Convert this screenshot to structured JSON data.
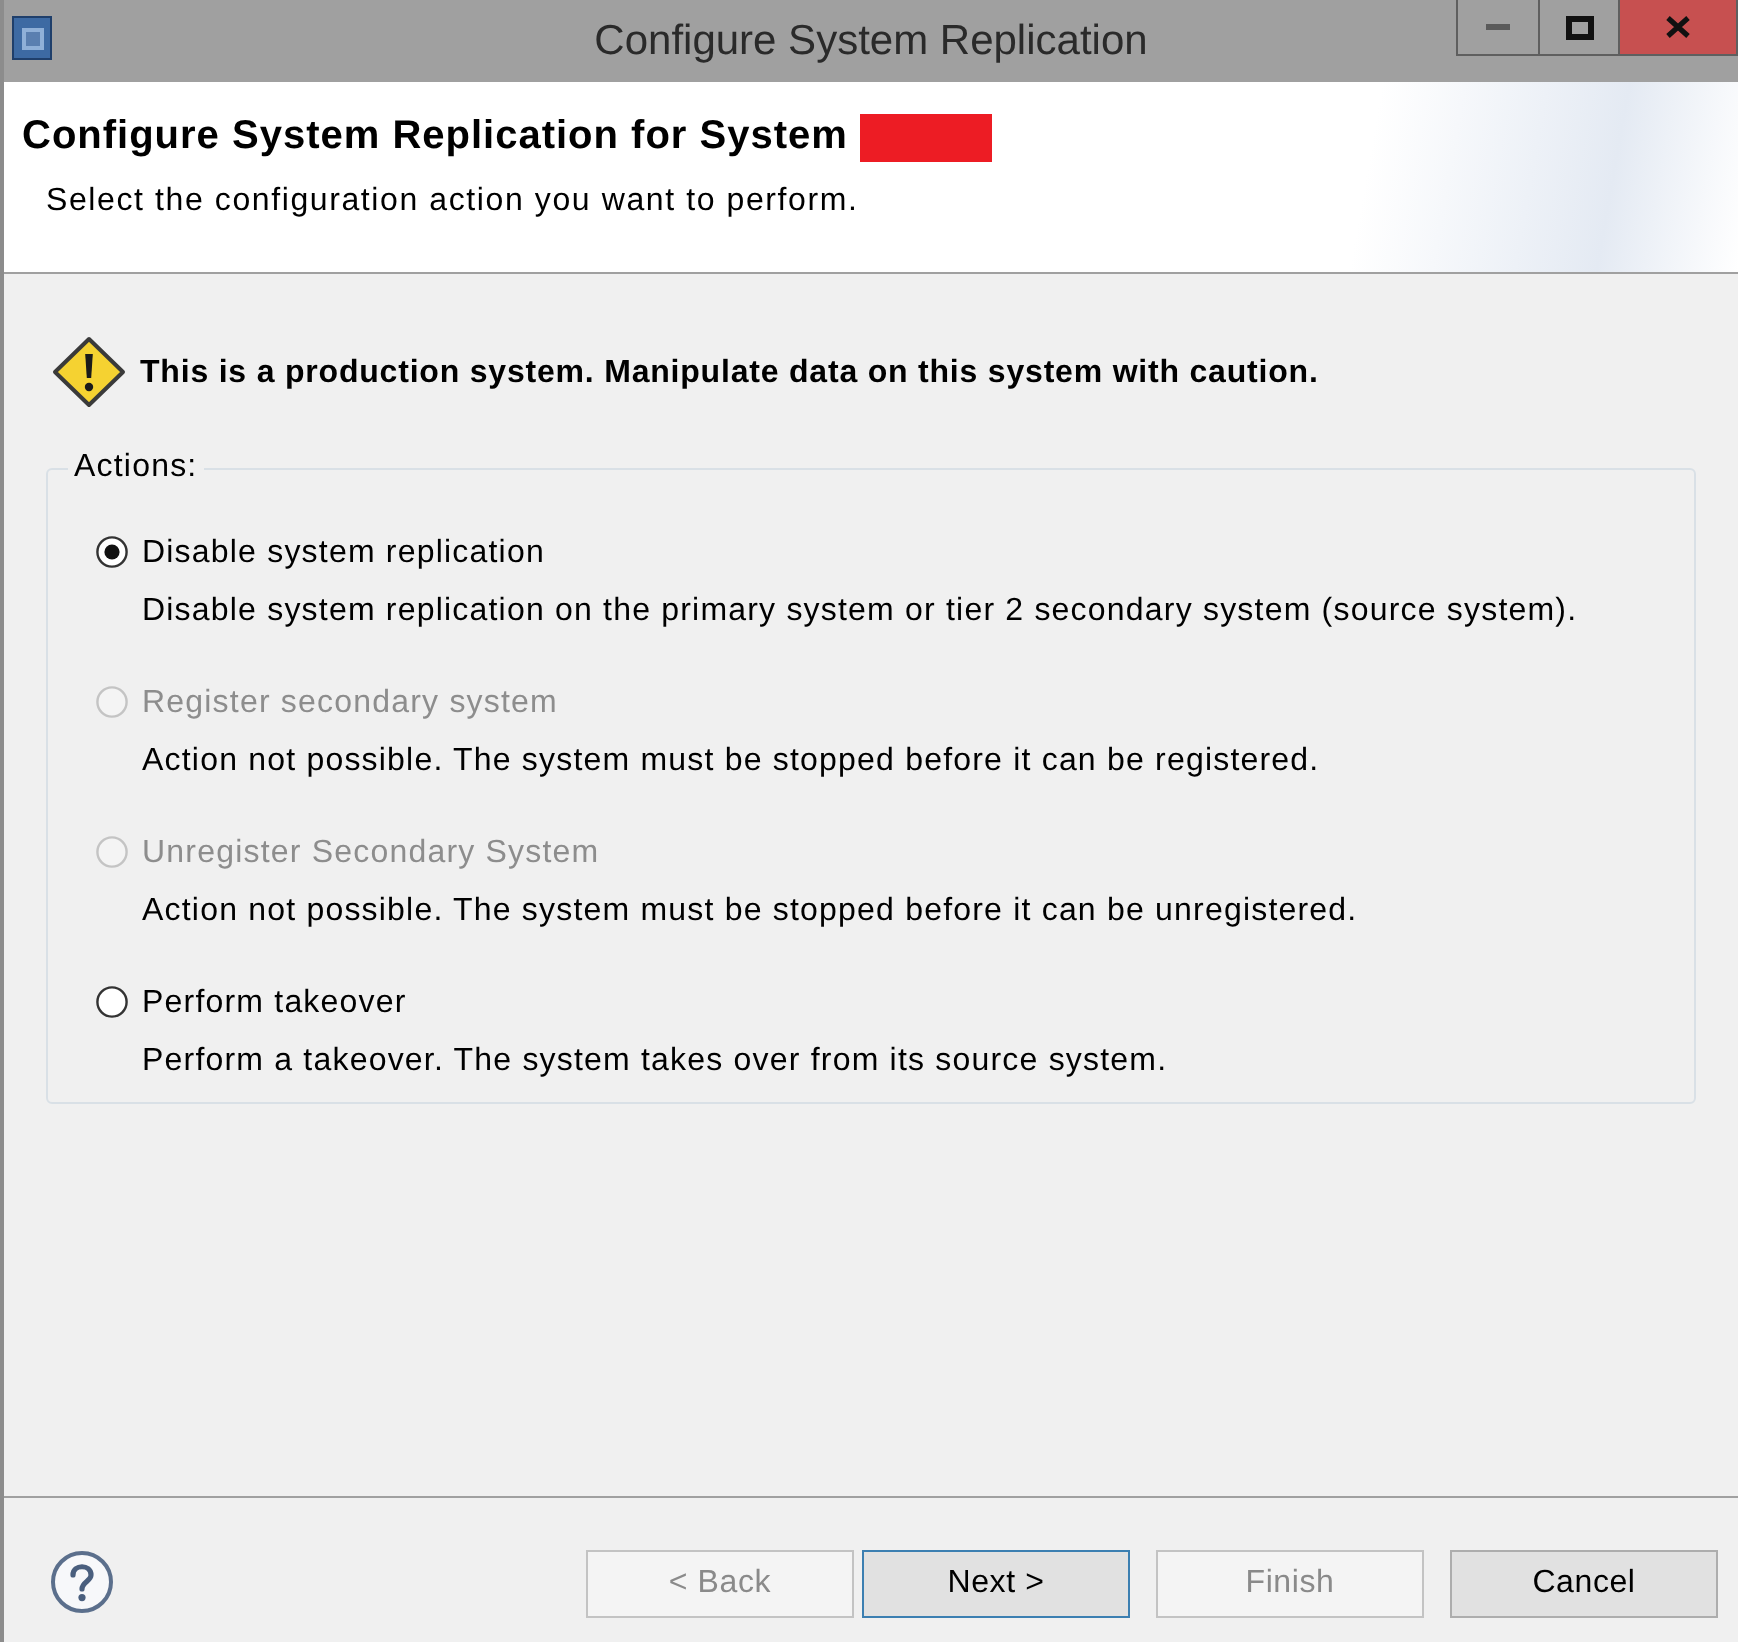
{
  "window": {
    "title": "Configure System Replication"
  },
  "header": {
    "title": "Configure System Replication for System",
    "redacted": true,
    "description": "Select the configuration action you want to perform."
  },
  "warning": {
    "text": "This is a production system. Manipulate data on this system with caution."
  },
  "actions": {
    "legend": "Actions:",
    "options": [
      {
        "label": "Disable system replication",
        "description": "Disable system replication on the primary system or tier 2 secondary system (source system).",
        "selected": true,
        "disabled": false
      },
      {
        "label": "Register secondary system",
        "description": "Action not possible. The system must be stopped before it can be registered.",
        "selected": false,
        "disabled": true
      },
      {
        "label": "Unregister Secondary System",
        "description": "Action not possible. The system must be stopped before it can be unregistered.",
        "selected": false,
        "disabled": true
      },
      {
        "label": "Perform takeover",
        "description": "Perform a takeover. The system takes over from its source system.",
        "selected": false,
        "disabled": false
      }
    ]
  },
  "buttons": [
    {
      "label": "< Back",
      "disabled": true,
      "default": false
    },
    {
      "label": "Next >",
      "disabled": false,
      "default": true
    },
    {
      "label": "Finish",
      "disabled": true,
      "default": false
    },
    {
      "label": "Cancel",
      "disabled": false,
      "default": false
    }
  ]
}
